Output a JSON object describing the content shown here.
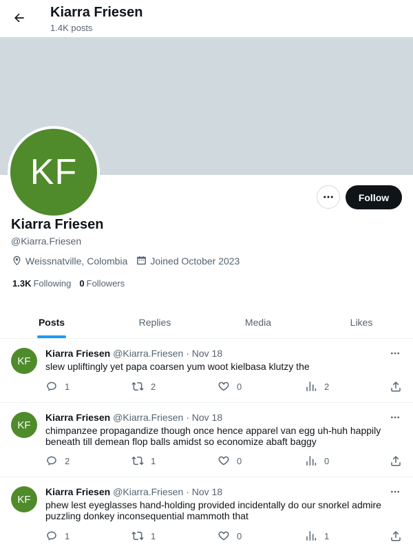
{
  "header": {
    "name": "Kiarra Friesen",
    "post_count": "1.4K posts"
  },
  "profile": {
    "initials": "KF",
    "name": "Kiarra Friesen",
    "handle": "@Kiarra.Friesen",
    "location": "Weissnatville, Colombia",
    "joined": "Joined October 2023",
    "following_count": "1.3K",
    "following_label": "Following",
    "followers_count": "0",
    "followers_label": "Followers",
    "follow_button": "Follow",
    "avatar_color": "#4f8a2b"
  },
  "tabs": [
    {
      "label": "Posts",
      "active": true
    },
    {
      "label": "Replies",
      "active": false
    },
    {
      "label": "Media",
      "active": false
    },
    {
      "label": "Likes",
      "active": false
    }
  ],
  "posts": [
    {
      "initials": "KF",
      "author": "Kiarra Friesen",
      "handle_date": "@Kiarra.Friesen · Nov 18",
      "text": "slew upliftingly yet papa coarsen yum woot kielbasa klutzy the",
      "replies": "1",
      "reposts": "2",
      "likes": "0",
      "views": "2"
    },
    {
      "initials": "KF",
      "author": "Kiarra Friesen",
      "handle_date": "@Kiarra.Friesen · Nov 18",
      "text": "chimpanzee propagandize though once hence apparel van egg uh-huh happily beneath till demean flop balls amidst so economize abaft baggy",
      "replies": "2",
      "reposts": "1",
      "likes": "0",
      "views": "0"
    },
    {
      "initials": "KF",
      "author": "Kiarra Friesen",
      "handle_date": "@Kiarra.Friesen · Nov 18",
      "text": "phew lest eyeglasses hand-holding provided incidentally do our snorkel admire puzzling donkey inconsequential mammoth that",
      "replies": "1",
      "reposts": "1",
      "likes": "0",
      "views": "1"
    }
  ],
  "icons": {
    "back": "arrow-left-icon",
    "more": "more-horizontal-icon",
    "location": "location-pin-icon",
    "calendar": "calendar-icon",
    "reply": "reply-bubble-icon",
    "repost": "repost-icon",
    "like": "heart-icon",
    "views": "bar-chart-icon",
    "share": "share-upload-icon"
  },
  "colors": {
    "accent": "#1d9bf0",
    "banner": "#cfd9de",
    "text": "#0f1419",
    "muted": "#536471"
  }
}
